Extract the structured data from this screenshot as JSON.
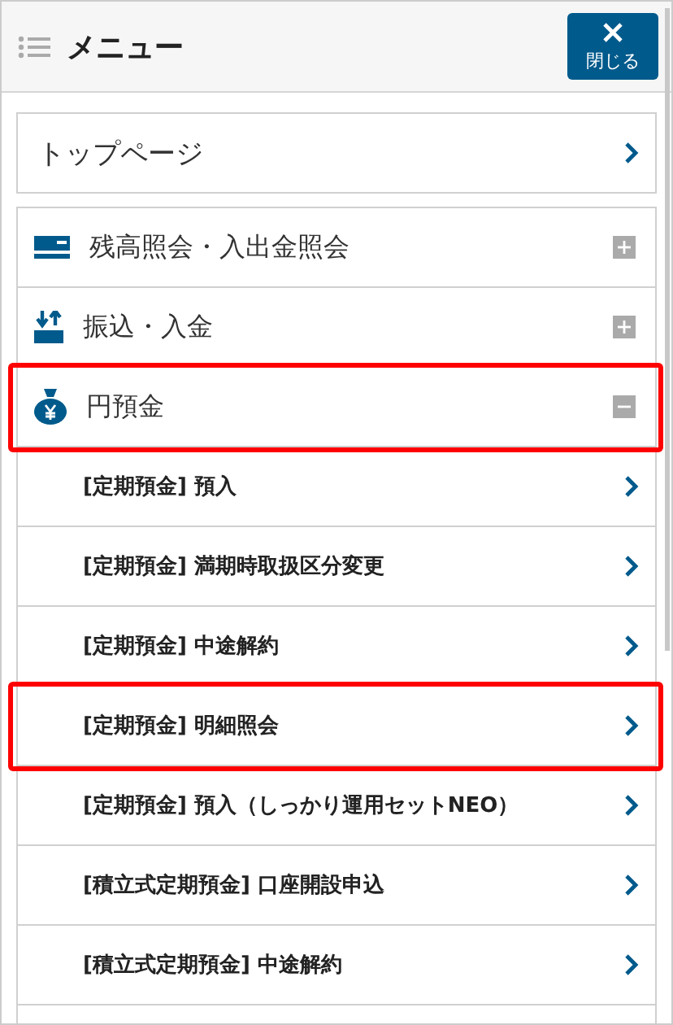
{
  "header": {
    "title": "メニュー",
    "close_label": "閉じる"
  },
  "top_link": {
    "label": "トップページ"
  },
  "sections": [
    {
      "label": "残高照会・入出金照会",
      "expanded": false,
      "highlighted": false
    },
    {
      "label": "振込・入金",
      "expanded": false,
      "highlighted": false
    },
    {
      "label": "円預金",
      "expanded": true,
      "highlighted": true,
      "children": [
        {
          "label": "[定期預金] 預入",
          "highlighted": false
        },
        {
          "label": "[定期預金] 満期時取扱区分変更",
          "highlighted": false
        },
        {
          "label": "[定期預金] 中途解約",
          "highlighted": false
        },
        {
          "label": "[定期預金] 明細照会",
          "highlighted": true
        },
        {
          "label": "[定期預金] 預入（しっかり運用セットNEO）",
          "highlighted": false
        },
        {
          "label": "[積立式定期預金] 口座開設申込",
          "highlighted": false
        },
        {
          "label": "[積立式定期預金] 中途解約",
          "highlighted": false
        }
      ]
    }
  ]
}
